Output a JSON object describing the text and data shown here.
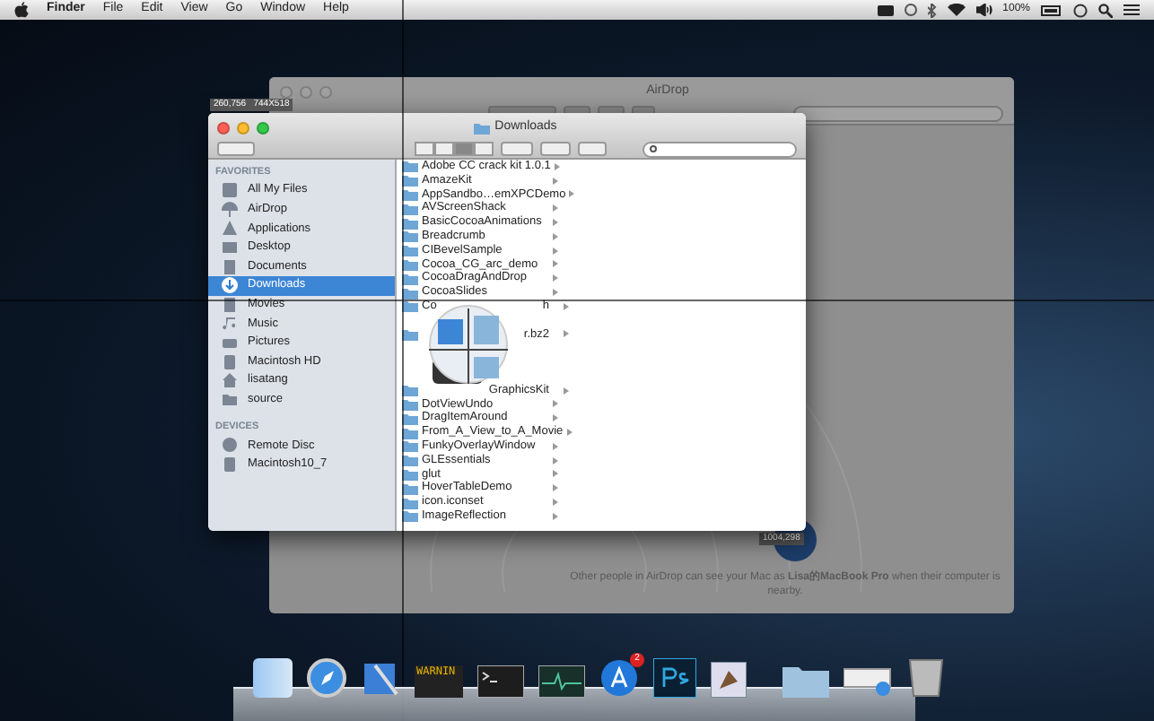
{
  "menu_bar": {
    "app": "Finder",
    "menus": [
      "File",
      "Edit",
      "View",
      "Go",
      "Window",
      "Help"
    ],
    "battery": "100%"
  },
  "capture_size_label": "260,756   744X518",
  "airdrop_window": {
    "title": "AirDrop",
    "note": "Other people in AirDrop can see your Mac as **Lisa的MacBook Pro** when their computer is nearby.",
    "position_label": "1004,298"
  },
  "finder_window": {
    "title": "Downloads",
    "sidebar": [
      {
        "heading": "FAVORITES",
        "items": [
          {
            "label": "All My Files",
            "selected": false
          },
          {
            "label": "AirDrop",
            "selected": false
          },
          {
            "label": "Applications",
            "selected": false
          },
          {
            "label": "Desktop",
            "selected": false
          },
          {
            "label": "Documents",
            "selected": false
          },
          {
            "label": "Downloads",
            "selected": true
          },
          {
            "label": "Movies",
            "selected": false
          },
          {
            "label": "Music",
            "selected": false
          },
          {
            "label": "Pictures",
            "selected": false
          },
          {
            "label": "Macintosh HD",
            "selected": false
          },
          {
            "label": "lisatang",
            "selected": false
          },
          {
            "label": "source",
            "selected": false
          }
        ]
      },
      {
        "heading": "DEVICES",
        "items": [
          {
            "label": "Remote Disc",
            "selected": false
          },
          {
            "label": "Macintosh10_7",
            "selected": false
          }
        ]
      }
    ],
    "files": [
      {
        "kind": "shown",
        "name": "Adobe CC crack kit 1.0.1"
      },
      {
        "kind": "shown",
        "name": "AmazeKit"
      },
      {
        "kind": "shown",
        "name": "AppSandbo…emXPCDemo"
      },
      {
        "kind": "shown",
        "name": "AVScreenShack"
      },
      {
        "kind": "shown",
        "name": "BasicCocoaAnimations"
      },
      {
        "kind": "shown",
        "name": "Breadcrumb"
      },
      {
        "kind": "shown",
        "name": "CIBevelSample"
      },
      {
        "kind": "shown",
        "name": "Cocoa_CG_arc_demo"
      },
      {
        "kind": "shown",
        "name": "CocoaDragAndDrop"
      },
      {
        "kind": "shown",
        "name": "CocoaSlides"
      },
      {
        "kind": "shown",
        "name": "Co",
        "tail": "h"
      },
      {
        "kind": "covered"
      },
      {
        "kind": "shown",
        "tail": "r.bz2"
      },
      {
        "kind": "covered"
      },
      {
        "kind": "covered"
      },
      {
        "kind": "covered"
      },
      {
        "kind": "shown",
        "tail": "GraphicsKit"
      },
      {
        "kind": "shown",
        "name": "DotViewUndo"
      },
      {
        "kind": "shown",
        "name": "DragItemAround"
      },
      {
        "kind": "shown",
        "name": "From_A_View_to_A_Movie"
      },
      {
        "kind": "shown",
        "name": "FunkyOverlayWindow"
      },
      {
        "kind": "shown",
        "name": "GLEssentials"
      },
      {
        "kind": "shown",
        "name": "glut"
      },
      {
        "kind": "shown",
        "name": "HoverTableDemo"
      },
      {
        "kind": "shown",
        "name": "icon.iconset"
      },
      {
        "kind": "shown",
        "name": "ImageReflection"
      }
    ]
  },
  "dock": {
    "app_store_badge": "2",
    "terminal_text": "WARNIN"
  }
}
